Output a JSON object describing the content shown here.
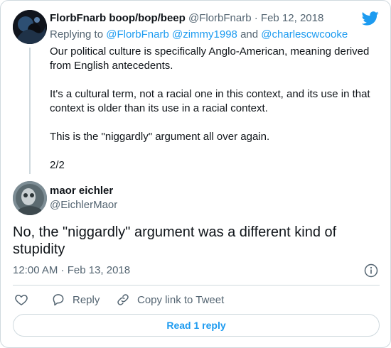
{
  "colors": {
    "link": "#1d9bf0",
    "text": "#0f1419",
    "muted": "#536471",
    "border": "#cfd9de"
  },
  "tweet1": {
    "name": "FlorbFnarb boop/bop/beep",
    "handle": "@FlorbFnarb",
    "separator": "·",
    "date": "Feb 12, 2018",
    "replying_prefix": "Replying to",
    "reply_handles": [
      "@FlorbFnarb",
      "@zimmy1998",
      "@charlescwcooke"
    ],
    "reply_conjunction": "and",
    "paragraphs": [
      "Our political culture is specifically Anglo-American, meaning derived from English antecedents.",
      "It's a cultural term, not a racial one in this context, and its use in that context is older than its use in a racial context.",
      "This is the \"niggardly\" argument all over again.",
      "2/2"
    ]
  },
  "tweet2": {
    "name": "maor eichler",
    "handle": "@EichlerMaor",
    "text": "No, the \"niggardly\" argument was a different kind of stupidity",
    "timestamp": "12:00 AM · Feb 13, 2018"
  },
  "actions": {
    "like_icon": "heart-icon",
    "reply_label": "Reply",
    "reply_icon": "speech-bubble-icon",
    "copy_label": "Copy link to Tweet",
    "copy_icon": "link-icon"
  },
  "icons": {
    "logo": "twitter-bird-icon",
    "info": "info-icon"
  },
  "read_button": "Read 1 reply"
}
